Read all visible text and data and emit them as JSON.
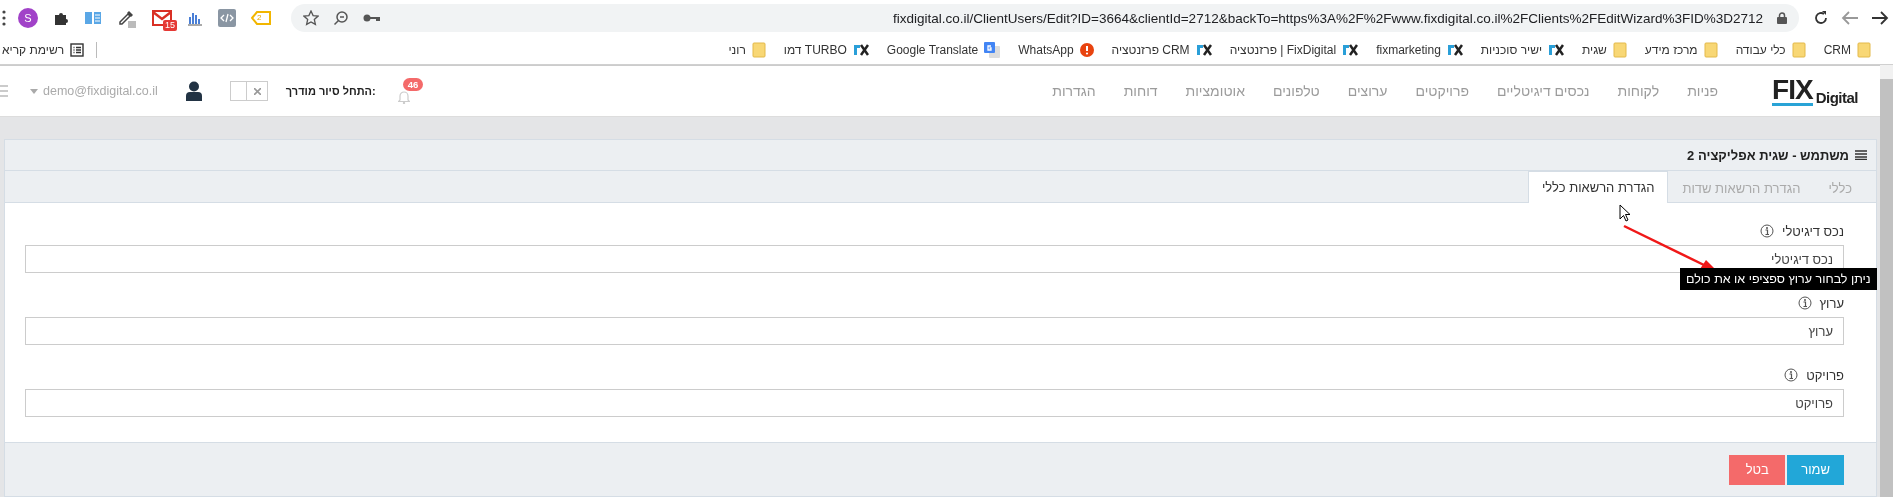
{
  "browser": {
    "extensions": [
      {
        "kind": "profile",
        "text": "S"
      },
      {
        "kind": "puzzle"
      },
      {
        "kind": "book"
      },
      {
        "kind": "dropper"
      },
      {
        "kind": "mail",
        "badge": "15"
      },
      {
        "kind": "chart"
      },
      {
        "kind": "code"
      },
      {
        "kind": "tag",
        "badge": "2"
      }
    ],
    "url": "fixdigital.co.il/ClientUsers/Edit?ID=3664&clientId=2712&backTo=https%3A%2F%2Fwww.fixdigital.co.il%2FClients%2FEditWizard%3FID%3D2712",
    "bookmarks": [
      {
        "kind": "folder",
        "label": "CRM"
      },
      {
        "kind": "folder",
        "label": "כלי עבודה"
      },
      {
        "kind": "folder",
        "label": "מרכז מידע"
      },
      {
        "kind": "folder",
        "label": "שגית"
      },
      {
        "kind": "fix",
        "label": "ישיר סוכניות"
      },
      {
        "kind": "fix",
        "label": "fixmarketing"
      },
      {
        "kind": "fix",
        "label": "פרזנטציה | FixDigital"
      },
      {
        "kind": "fix",
        "label": "פרזנטציה CRM"
      },
      {
        "kind": "alert",
        "label": "WhatsApp"
      },
      {
        "kind": "translate",
        "label": "Google Translate"
      },
      {
        "kind": "fix",
        "label": "דמו TURBO"
      },
      {
        "kind": "folder",
        "label": "רוני"
      }
    ],
    "reading_list": {
      "label": "רשימת קריא"
    }
  },
  "header": {
    "logo": {
      "mark": "FIX",
      "text": "Digital"
    },
    "nav": [
      "פניות",
      "לקוחות",
      "נכסים דיגיטליים",
      "פרויקטים",
      "ערוצים",
      "טלפונים",
      "אוטומציות",
      "דוחות",
      "הגדרות"
    ],
    "notifications": {
      "badge": "46"
    },
    "tour": {
      "label": "התחל סיור מודרך:",
      "on": false
    },
    "user": {
      "email": "demo@fixdigital.co.il"
    }
  },
  "panel": {
    "title": "משתמש - שגית אפליקציה 2",
    "tabs": [
      {
        "label": "כללי",
        "selected": false
      },
      {
        "label": "הגדרת הרשאות שדות",
        "selected": false
      },
      {
        "label": "הגדרת הרשאות כללי",
        "selected": true
      }
    ],
    "fields": [
      {
        "label": "נכס דיגיטלי",
        "value": "נכס דיגיטלי"
      },
      {
        "label": "ערוץ",
        "value": "ערוץ"
      },
      {
        "label": "פרויקט",
        "value": "פרויקט"
      }
    ],
    "tooltip": {
      "text": "ניתן לבחור ערוץ ספציפי או את כולם"
    },
    "buttons": [
      {
        "kind": "primary",
        "label": "שמור"
      },
      {
        "kind": "danger",
        "label": "בטל"
      }
    ]
  }
}
